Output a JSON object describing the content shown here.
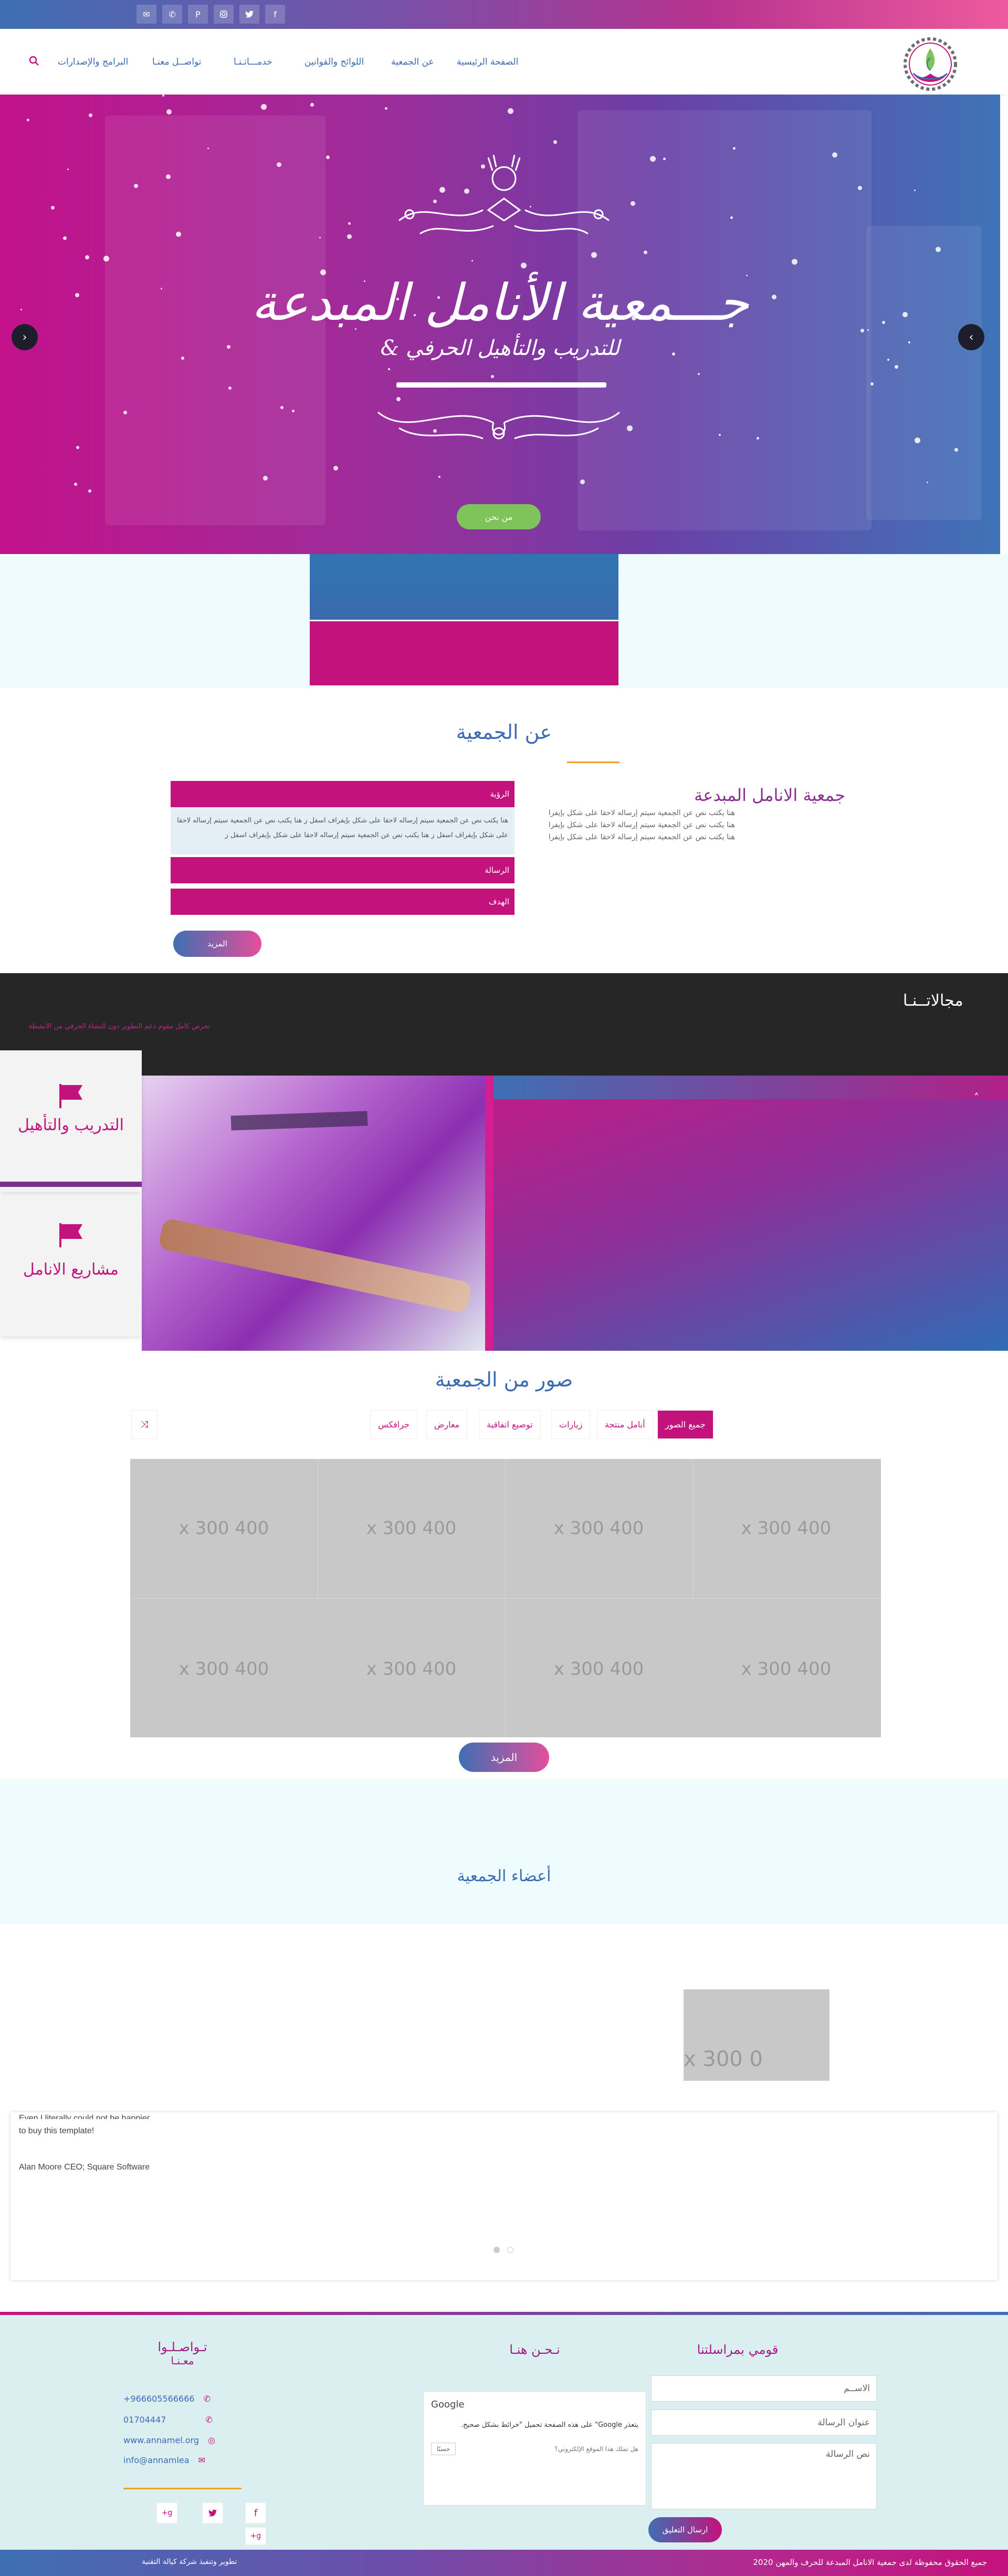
{
  "colors": {
    "pink": "#c4127d",
    "blue": "#3a6bb3",
    "purple": "#8a2f92",
    "green": "#7fc35b",
    "orange": "#f0a020"
  },
  "topbar": {
    "social_icons": [
      "facebook-icon",
      "twitter-icon",
      "instagram-icon",
      "pinterest-icon",
      "phone-icon",
      "email-icon"
    ]
  },
  "nav": {
    "items": [
      "الصفحة الرئيسية",
      "عن الجمعية",
      "اللوائح والقوانين",
      "خدمـــاتـنـا",
      "تواصــل معنـا",
      "البرامج والإصدارات"
    ],
    "search_icon": "search-icon"
  },
  "hero": {
    "title": "جـــمعية الأنامل المبدعة",
    "subtitle": "للتدريب والتأهيل الحرفي &",
    "button": "من نحن",
    "prev_icon": "chevron-left-icon",
    "next_icon": "chevron-right-icon"
  },
  "about": {
    "title": "عن الجمعية",
    "org_name": "جمعية الانامل المبدعة",
    "lines": [
      "هنا يكتب نص عن الجمعية سيتم إرساله لاحقا على شكل بإيفرا",
      "هنا يكتب نص عن الجمعية سيتم إرساله لاحقا على شكل بإيفرا",
      "هنا يكتب نص عن الجمعية سيتم إرساله لاحقا على شكل بإيفرا"
    ],
    "accordion": [
      {
        "label": "الرؤية",
        "body": "هنا يكتب نص عن الجمعية سيتم إرساله لاحقا على شكل بإيفراف اسفل ز هنا يكتب نص عن الجمعية سيتم إرساله لاحقا على شكل بإيفراف اسفل ز هنا يكتب نص عن الجمعية سيتم إرساله لاحقا على شكل بإيفراف اسفل ز"
      },
      {
        "label": "الرسالة"
      },
      {
        "label": "الهدف"
      }
    ],
    "more_button": "المزيد"
  },
  "fields": {
    "title": "مجالاتــنـا",
    "description": "نحرص كامل مقوم دعم التطوير دون النشأة الحرفي من الأنشطة",
    "cards": [
      {
        "label": "التدريب والتأهيل",
        "icon": "flag-icon"
      },
      {
        "label": "مشاريع الانامل",
        "icon": "flag-icon"
      }
    ],
    "scroll_icon": "chevron-up-icon"
  },
  "gallery": {
    "title": "صور من الجمعية",
    "tabs": [
      "جميع الصور",
      "أنامل منتجة",
      "زيارات",
      "توصيع اتفاقية",
      "معارض",
      "جرافكس"
    ],
    "shuffle_icon": "shuffle-icon",
    "placeholder": "400 x 300",
    "more_button": "المزيد"
  },
  "members": {
    "title": "أعضاء الجمعية",
    "placeholder": "0 x 300"
  },
  "testimonial": {
    "text_line1": "Even I literally could not be happier",
    "text_line2": "to buy this template!",
    "author": "Alan Moore CEO; Square Software"
  },
  "footer": {
    "contact_form": {
      "title": "قومي بمراسلتنا",
      "name_placeholder": "الاســم",
      "subject_placeholder": "عنوان الرسالة",
      "message_placeholder": "نص الرسالة",
      "send_button": "ارسال التعليق"
    },
    "map": {
      "title": "نـحـن هنـا",
      "google_label": "Google",
      "error_text": "يتعذر Google\" على هذه الصفحة تحميل \"خرائط بشكل صحيح.",
      "question": "هل تملك هذا الموقع الإلكتروني؟",
      "ok_button": "حسنًا"
    },
    "contact": {
      "title_line1": "تـواصـلـوا",
      "title_line2": "معـنـا",
      "phone1": "+966605566666",
      "phone2": "01704447",
      "website": "www.annamel.org",
      "email": "info@annamlea"
    },
    "social_icons": [
      "facebook-icon",
      "twitter-icon",
      "google-plus-icon",
      "google-plus-icon"
    ],
    "copyright": "جميع الحقوق محفوظة لدى جمعية الانامل المبدعة للحرف والمهن 2020",
    "credit": "تطوير وتنفيذ شركة كيالة التقنية"
  }
}
